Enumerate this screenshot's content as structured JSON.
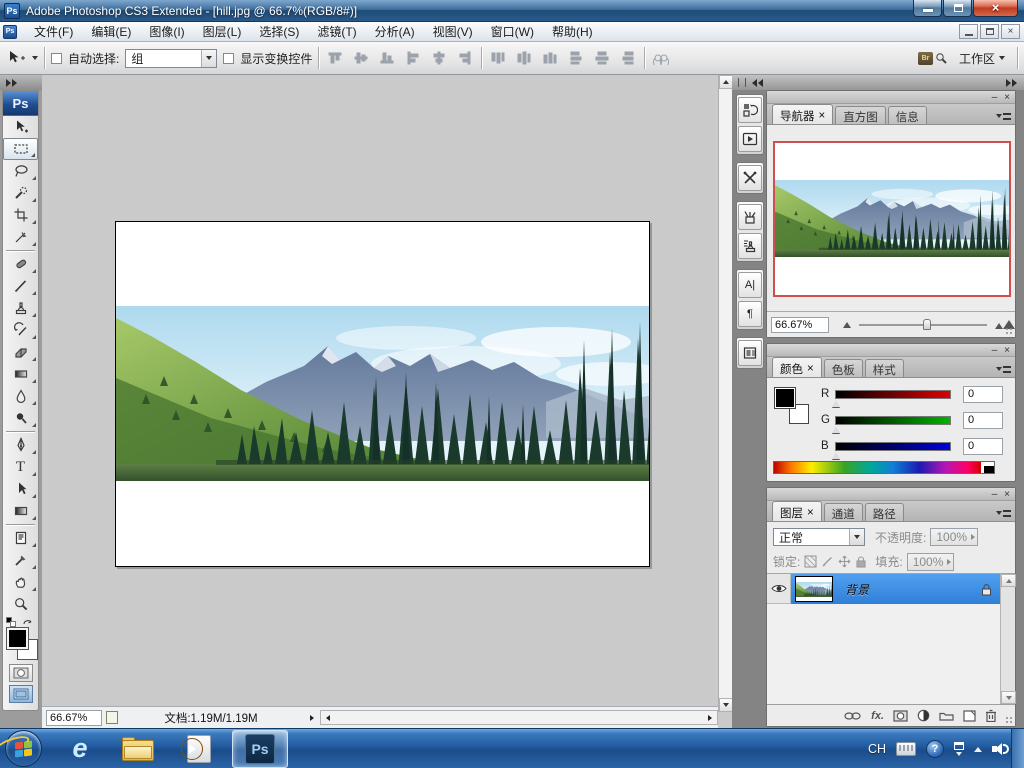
{
  "window": {
    "title": "Adobe Photoshop CS3 Extended - [hill.jpg @ 66.7%(RGB/8#)]",
    "app_badge": "Ps"
  },
  "menu_bar": {
    "items": [
      "文件(F)",
      "编辑(E)",
      "图像(I)",
      "图层(L)",
      "选择(S)",
      "滤镜(T)",
      "分析(A)",
      "视图(V)",
      "窗口(W)",
      "帮助(H)"
    ]
  },
  "options_bar": {
    "auto_select_label": "自动选择:",
    "auto_select_value": "组",
    "show_transform_label": "显示变换控件",
    "workspace_label": "工作区"
  },
  "tools_panel": {
    "logo": "Ps"
  },
  "navigator": {
    "tabs": [
      "导航器",
      "直方图",
      "信息"
    ],
    "zoom_value": "66.67%"
  },
  "color_panel": {
    "tabs": [
      "颜色",
      "色板",
      "样式"
    ],
    "channels": [
      {
        "label": "R",
        "value": "0"
      },
      {
        "label": "G",
        "value": "0"
      },
      {
        "label": "B",
        "value": "0"
      }
    ]
  },
  "layers_panel": {
    "tabs": [
      "图层",
      "通道",
      "路径"
    ],
    "blend_mode": "正常",
    "opacity_label": "不透明度:",
    "opacity_value": "100%",
    "lock_label": "锁定:",
    "fill_label": "填充:",
    "fill_value": "100%",
    "layer_name": "背景",
    "fx_label": "fx."
  },
  "status_bar": {
    "zoom": "66.67%",
    "doc_info": "文档:1.19M/1.19M"
  },
  "taskbar": {
    "ps_badge": "Ps",
    "tray_lang": "CH",
    "help_glyph": "?",
    "ie_glyph": "e"
  },
  "glyphs": {
    "tab_close": "×",
    "panel_min": "–",
    "panel_close": "×",
    "character_panel": "A|",
    "paragraph_panel": "¶",
    "type_tool": "T",
    "bridge": "Br"
  },
  "colors": {
    "selection_blue": "#2f7fd8",
    "navigator_frame_red": "#cf4f4f",
    "foreground": "#000000",
    "background": "#ffffff",
    "titlebar_blue": "#2a5a8a",
    "taskbar_blue": "#225a9e"
  }
}
